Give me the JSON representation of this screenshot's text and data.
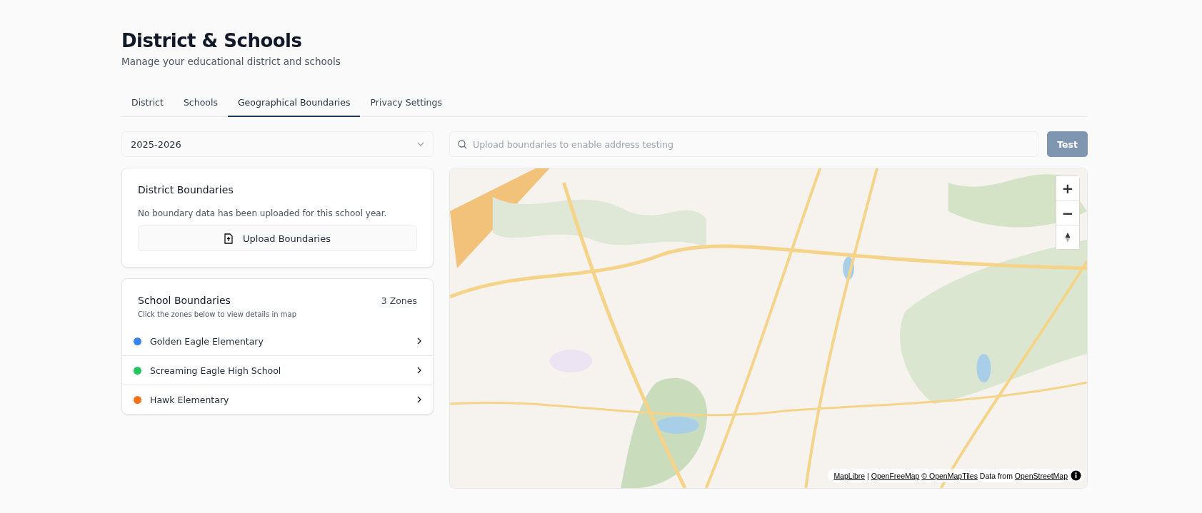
{
  "header": {
    "title": "District & Schools",
    "subtitle": "Manage your educational district and schools"
  },
  "tabs": [
    {
      "label": "District",
      "selected": false
    },
    {
      "label": "Schools",
      "selected": false
    },
    {
      "label": "Geographical Boundaries",
      "selected": true
    },
    {
      "label": "Privacy Settings",
      "selected": false
    }
  ],
  "year_select": {
    "value": "2025-2026"
  },
  "district_boundaries": {
    "title": "District Boundaries",
    "message": "No boundary data has been uploaded for this school year.",
    "upload_button": "Upload Boundaries"
  },
  "school_boundaries": {
    "title": "School Boundaries",
    "count": "3 Zones",
    "hint": "Click the zones below to view details in map",
    "zones": [
      {
        "name": "Golden Eagle Elementary",
        "color": "#3b82f6"
      },
      {
        "name": "Screaming Eagle High School",
        "color": "#22c55e"
      },
      {
        "name": "Hawk Elementary",
        "color": "#f97316"
      }
    ]
  },
  "address_search": {
    "placeholder": "Upload boundaries to enable address testing",
    "button": "Test",
    "disabled": true
  },
  "map": {
    "kind": "picture",
    "zoom_in": "+",
    "zoom_out": "−",
    "attribution": [
      {
        "kind": "link",
        "text": "MapLibre"
      },
      {
        "kind": "text",
        "text": "|"
      },
      {
        "kind": "link",
        "text": "OpenFreeMap"
      },
      {
        "kind": "link",
        "text": "© OpenMapTiles"
      },
      {
        "kind": "text",
        "text": "Data from"
      },
      {
        "kind": "link",
        "text": "OpenStreetMap"
      }
    ]
  }
}
